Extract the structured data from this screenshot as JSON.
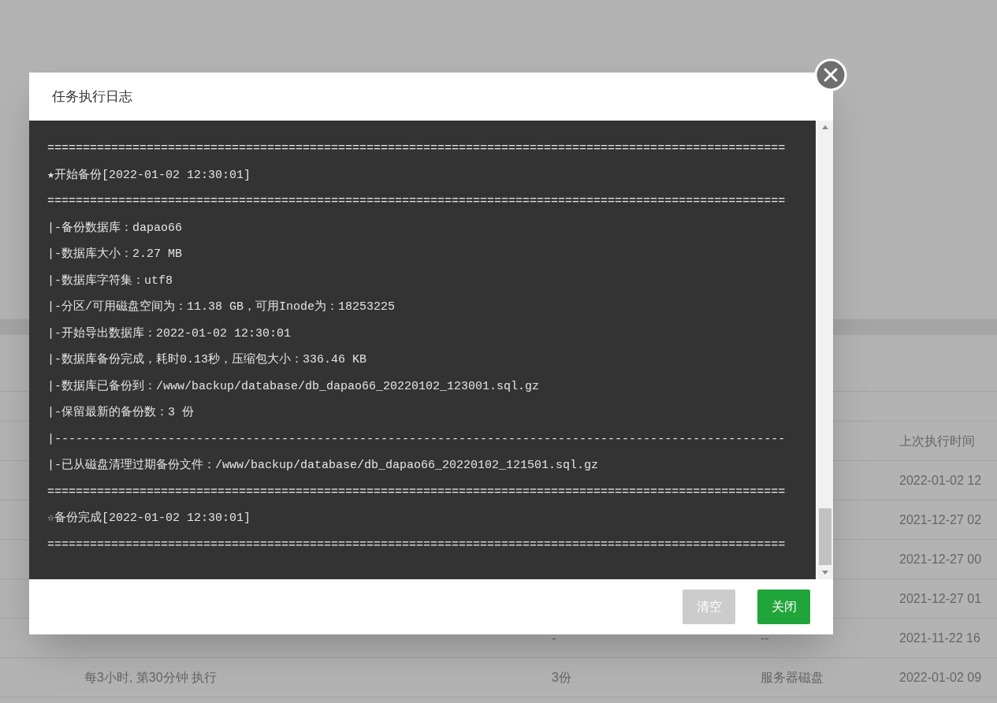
{
  "background_table": {
    "header": {
      "column_4": "上次执行时间"
    },
    "rows": [
      {
        "column_4": "2022-01-02 12"
      },
      {
        "column_4": "2021-12-27 02"
      },
      {
        "column_4": "2021-12-27 00"
      },
      {
        "column_4": "2021-12-27 01"
      },
      {
        "column_2": "-",
        "column_3": "--",
        "column_4": "2021-11-22 16"
      },
      {
        "column_1": "每3小时, 第30分钟 执行",
        "column_2": "3份",
        "column_3": "服务器磁盘",
        "column_4": "2022-01-02 09"
      }
    ]
  },
  "dialog": {
    "title": "任务执行日志",
    "log_lines": [
      "========================================================================================================",
      "★开始备份[2022-01-02 12:30:01]",
      "========================================================================================================",
      "|-备份数据库：dapao66",
      "|-数据库大小：2.27 MB",
      "|-数据库字符集：utf8",
      "|-分区/可用磁盘空间为：11.38 GB，可用Inode为：18253225",
      "|-开始导出数据库：2022-01-02 12:30:01",
      "|-数据库备份完成，耗时0.13秒，压缩包大小：336.46 KB",
      "|-数据库已备份到：/www/backup/database/db_dapao66_20220102_123001.sql.gz",
      "|-保留最新的备份数：3 份",
      "|-------------------------------------------------------------------------------------------------------",
      "|-已从磁盘清理过期备份文件：/www/backup/database/db_dapao66_20220102_121501.sql.gz",
      "========================================================================================================",
      "☆备份完成[2022-01-02 12:30:01]",
      "========================================================================================================"
    ],
    "buttons": [
      {
        "label": "清空",
        "disabled": true
      },
      {
        "label": "关闭",
        "disabled": false
      }
    ]
  }
}
